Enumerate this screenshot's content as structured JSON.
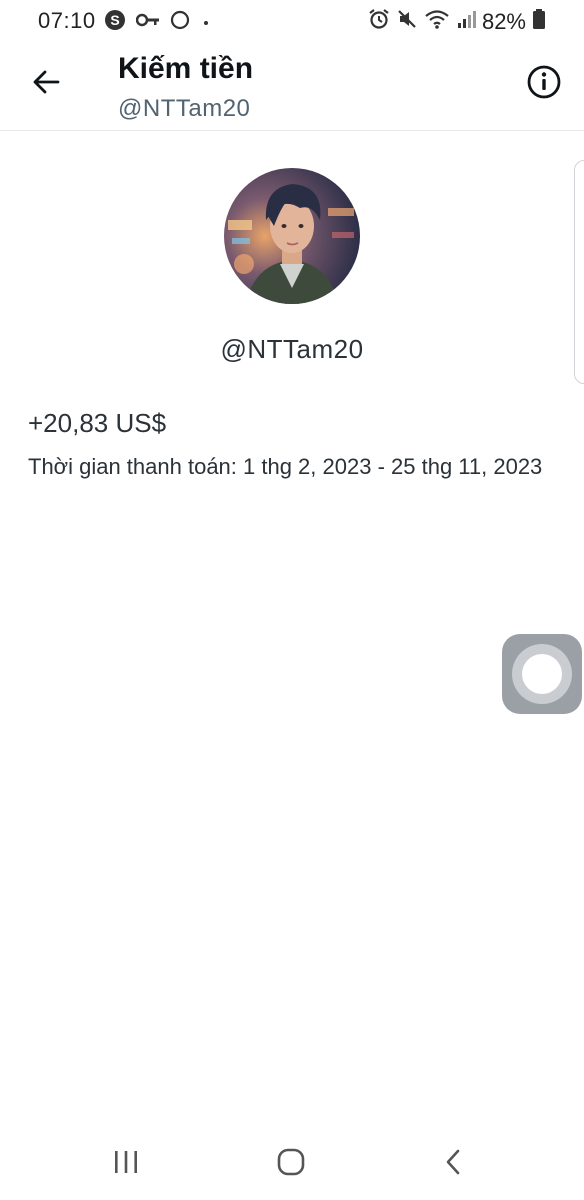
{
  "status_bar": {
    "time": "07:10",
    "battery": "82%",
    "left_icons": [
      "skype-icon",
      "key-icon",
      "circle-icon",
      "dot-icon"
    ],
    "right_icons": [
      "alarm-icon",
      "mute-icon",
      "wifi-icon",
      "signal-icon",
      "battery-icon"
    ]
  },
  "header": {
    "title": "Kiếm tiền",
    "subtitle": "@NTTam20",
    "back_icon": "arrow-left-icon",
    "info_icon": "info-icon"
  },
  "profile": {
    "username": "@NTTam20"
  },
  "earnings": {
    "amount": "+20,83 US$",
    "period": "Thời gian thanh toán: 1 thg 2, 2023 - 25 thg 11, 2023"
  },
  "nav_bar": {
    "icons": [
      "recents-icon",
      "home-icon",
      "back-icon"
    ]
  },
  "colors": {
    "text_primary": "#0f1419",
    "text_secondary": "#536471",
    "divider": "#e7e9ea"
  }
}
